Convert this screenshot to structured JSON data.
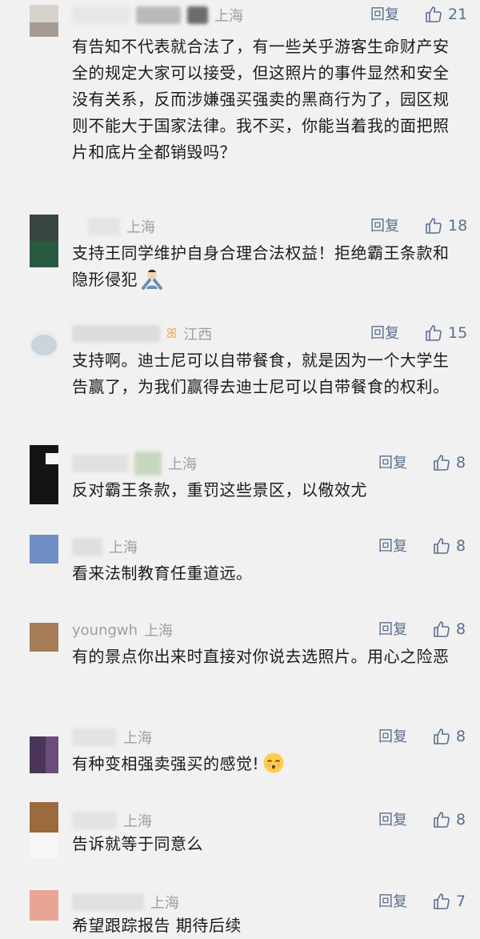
{
  "comments": [
    {
      "username": "",
      "location": "上海",
      "reply": "回复",
      "likes": "21",
      "text": "有告知不代表就合法了，有一些关乎游客生命财产安全的规定大家可以接受，但这照片的事件显然和安全没有关系，反而涉嫌强买强卖的黑商行为了，园区规则不能大于国家法律。我不买，你能当着我的面把照片和底片全都销毁吗？"
    },
    {
      "username": "",
      "location": "上海",
      "reply": "回复",
      "likes": "18",
      "text": "支持王同学维护自身合理合法权益！拒绝霸王条款和隐形侵犯"
    },
    {
      "username": "",
      "location": "江西",
      "reply": "回复",
      "likes": "15",
      "text": "支持啊。迪士尼可以自带餐食，就是因为一个大学生告赢了，为我们赢得去迪士尼可以自带餐食的权利。"
    },
    {
      "username": "",
      "location": "上海",
      "reply": "回复",
      "likes": "8",
      "text": "反对霸王条款，重罚这些景区，以儆效尤"
    },
    {
      "username": "",
      "location": "上海",
      "reply": "回复",
      "likes": "8",
      "text": "看来法制教育任重道远。"
    },
    {
      "username": "youngwh",
      "location": "上海",
      "reply": "回复",
      "likes": "8",
      "text": "有的景点你出来时直接对你说去选照片。用心之险恶"
    },
    {
      "username": "",
      "location": "上海",
      "reply": "回复",
      "likes": "8",
      "text": "有种变相强卖强买的感觉!"
    },
    {
      "username": "",
      "location": "上海",
      "reply": "回复",
      "likes": "8",
      "text": "告诉就等于同意么"
    },
    {
      "username": "",
      "location": "上海",
      "reply": "回复",
      "likes": "7",
      "text": "希望跟踪报告 期待后续"
    }
  ],
  "colors": {
    "background": "#f1f1f1",
    "meta_gray": "#9aa0a6",
    "action_blue": "#5a6f8f",
    "text": "#1b1b1b"
  }
}
